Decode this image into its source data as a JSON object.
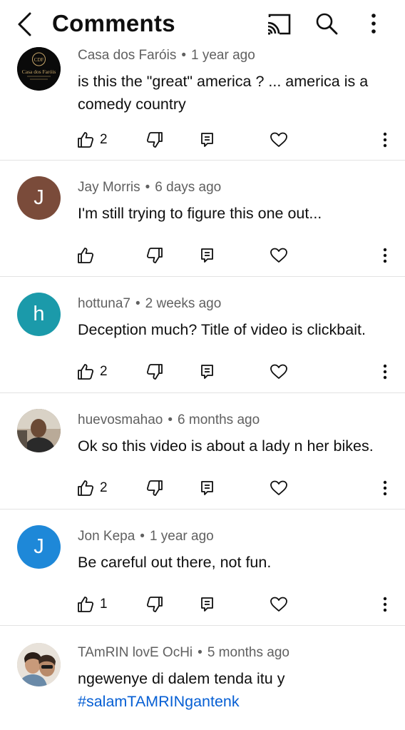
{
  "header": {
    "title": "Comments",
    "icons": [
      "back-arrow-icon",
      "cast-icon",
      "search-icon",
      "more-vert-icon"
    ]
  },
  "colors": {
    "text": "#0f0f0f",
    "meta": "#606060",
    "hashtag": "#065fd4",
    "divider": "#e3e3e3"
  },
  "comments": [
    {
      "author": "Casa dos Faróis",
      "time": "1 year ago",
      "text": "is this the \"great\" america ? ... america is a comedy country",
      "likes": "2",
      "avatar_type": "logo",
      "avatar_logo_text": "Casa dos Faróis",
      "avatar_logo_initials": "CDF"
    },
    {
      "author": "Jay Morris",
      "time": "6 days ago",
      "text": "I'm still trying to figure this one out...",
      "likes": "",
      "avatar_type": "letter",
      "avatar_letter": "J",
      "avatar_color": "#7a4b3a"
    },
    {
      "author": "hottuna7",
      "time": "2 weeks ago",
      "text": "Deception much? Title of video is clickbait.",
      "likes": "2",
      "avatar_type": "letter",
      "avatar_letter": "h",
      "avatar_color": "#1b9aaa"
    },
    {
      "author": "huevosmahao",
      "time": "6 months ago",
      "text": "Ok so this video is about a lady n her bikes.",
      "likes": "2",
      "avatar_type": "photo"
    },
    {
      "author": "Jon Kepa",
      "time": "1 year ago",
      "text": "Be careful out there, not fun.",
      "likes": "1",
      "avatar_type": "letter",
      "avatar_letter": "J",
      "avatar_color": "#1e88d8"
    },
    {
      "author": "TAmRIN lovE OcHi",
      "time": "5 months ago",
      "text": "ngewenye di dalem tenda itu y",
      "hashtag": "#salamTAMRINgantenk",
      "avatar_type": "photo"
    }
  ]
}
